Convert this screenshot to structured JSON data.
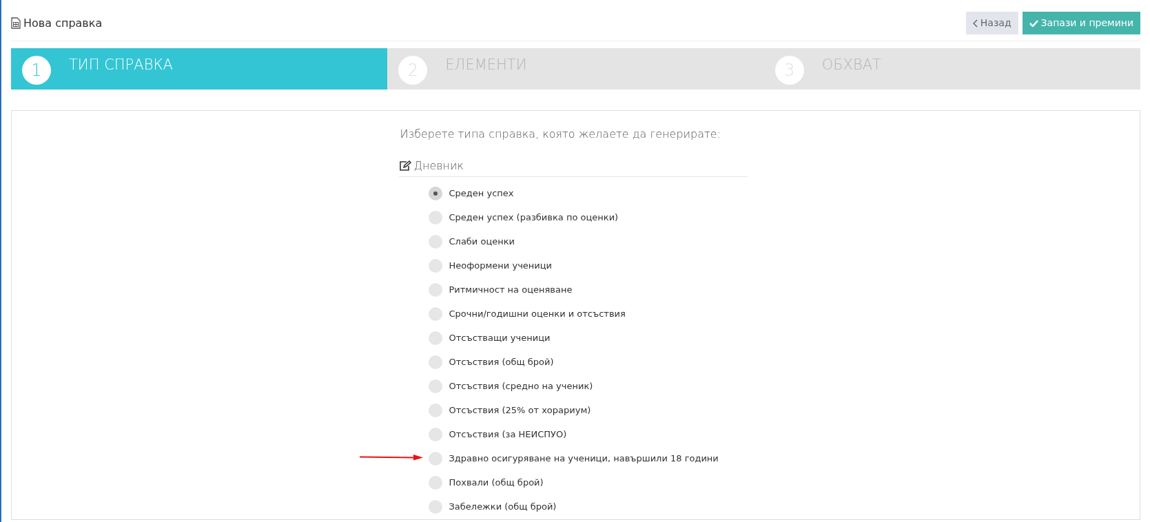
{
  "header": {
    "title": "Нова справка"
  },
  "buttons": [
    {
      "kind": "back",
      "label": "Назад"
    },
    {
      "kind": "save",
      "label": "Запази и премини"
    }
  ],
  "steps": [
    {
      "number": "1",
      "label": "ТИП СПРАВКА",
      "selected": true
    },
    {
      "number": "2",
      "label": "ЕЛЕМЕНТИ",
      "selected": false
    },
    {
      "number": "3",
      "label": "ОБХВАТ",
      "selected": false
    }
  ],
  "prompt": "Изберете типа справка, която желаете да генерирате:",
  "section": {
    "title": "Дневник",
    "options": [
      {
        "label": "Среден успех",
        "selected": true,
        "marked": false
      },
      {
        "label": "Среден успех (разбивка по оценки)",
        "selected": false,
        "marked": false
      },
      {
        "label": "Слаби оценки",
        "selected": false,
        "marked": false
      },
      {
        "label": "Неоформени ученици",
        "selected": false,
        "marked": false
      },
      {
        "label": "Ритмичност на оценяване",
        "selected": false,
        "marked": false
      },
      {
        "label": "Срочни/годишни оценки и отсъствия",
        "selected": false,
        "marked": false
      },
      {
        "label": "Отсъстващи ученици",
        "selected": false,
        "marked": false
      },
      {
        "label": "Отсъствия (общ брой)",
        "selected": false,
        "marked": false
      },
      {
        "label": "Отсъствия (средно на ученик)",
        "selected": false,
        "marked": false
      },
      {
        "label": "Отсъствия (25% от хорариум)",
        "selected": false,
        "marked": false
      },
      {
        "label": "Отсъствия (за НЕИСПУО)",
        "selected": false,
        "marked": false
      },
      {
        "label": "Здравно осигуряване на ученици, навършили 18 години",
        "selected": false,
        "marked": true
      },
      {
        "label": "Похвали (общ брой)",
        "selected": false,
        "marked": false
      },
      {
        "label": "Забележки (общ брой)",
        "selected": false,
        "marked": false
      }
    ]
  }
}
